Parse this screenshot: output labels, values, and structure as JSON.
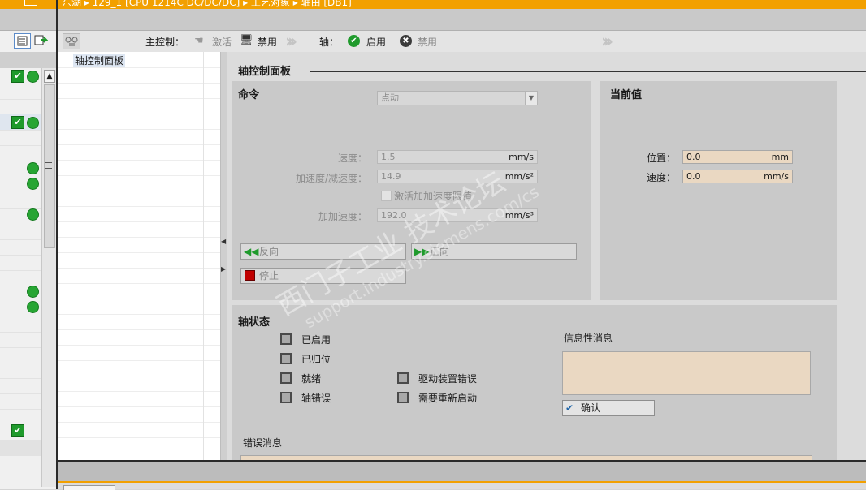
{
  "title_bar": {
    "breadcrumb": "东湖 ▸ 129_1 [CPU 1214C DC/DC/DC] ▸ 工艺对象 ▸ 轴由 [DB1]"
  },
  "toolbar": {
    "main_control_label": "主控制：",
    "activate_label": "激活",
    "disable_label": "禁用",
    "axis_label": "轴：",
    "enable_label": "启用",
    "axis_disable_label": "禁用"
  },
  "tree": {
    "item": "轴控制面板"
  },
  "panel": {
    "title": "轴控制面板"
  },
  "command": {
    "header": "命令",
    "mode_value": "点动",
    "speed_label": "速度：",
    "speed_value": "1.5",
    "speed_unit": "mm/s",
    "accel_label": "加速度/减速度：",
    "accel_value": "14.9",
    "accel_unit": "mm/s²",
    "jerk_checkbox_label": "激活加加速度限值",
    "jerk_label": "加加速度：",
    "jerk_value": "192.0",
    "jerk_unit": "mm/s³",
    "reverse_label": "反向",
    "forward_label": "正向",
    "stop_label": "停止"
  },
  "current": {
    "header": "当前值",
    "position_label": "位置：",
    "position_value": "0.0",
    "position_unit": "mm",
    "speed_label": "速度：",
    "speed_value": "0.0",
    "speed_unit": "mm/s"
  },
  "status": {
    "header": "轴状态",
    "items": [
      "已启用",
      "已归位",
      "就绪",
      "轴错误",
      "驱动装置错误",
      "需要重新启动"
    ],
    "info_label": "信息性消息",
    "confirm_label": "确认",
    "error_label": "错误消息"
  },
  "watermark": {
    "line1": "西门子工业 技术论坛",
    "line2": "support.industry.siemens.com/cs"
  },
  "colors": {
    "accent_orange": "#f2a000",
    "status_green": "#1f9a2c",
    "value_field": "#ead8c2",
    "stop_red": "#c00000"
  }
}
